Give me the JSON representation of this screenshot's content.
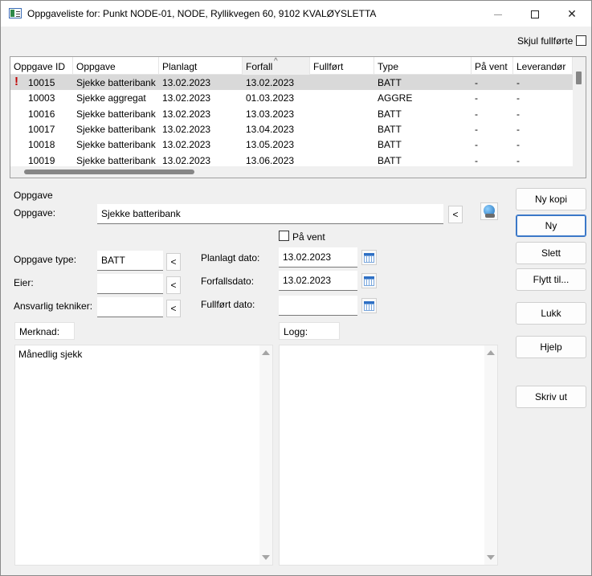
{
  "window": {
    "title": "Oppgaveliste for: Punkt NODE-01, NODE, Ryllikvegen 60, 9102 KVALØYSLETTA"
  },
  "hide_completed_label": "Skjul fullførte",
  "grid": {
    "columns": [
      "Oppgave ID",
      "Oppgave",
      "Planlagt",
      "Forfall",
      "Fullført",
      "Type",
      "På vent",
      "Leverandør"
    ],
    "sort_indicator": "^",
    "rows": [
      {
        "warn": "!",
        "id": "10015",
        "task": "Sjekke batteribank",
        "planned": "13.02.2023",
        "due": "13.02.2023",
        "done": "",
        "type": "BATT",
        "onhold": "-",
        "supplier": "-"
      },
      {
        "warn": "",
        "id": "10003",
        "task": "Sjekke aggregat",
        "planned": "13.02.2023",
        "due": "01.03.2023",
        "done": "",
        "type": "AGGRE",
        "onhold": "-",
        "supplier": "-"
      },
      {
        "warn": "",
        "id": "10016",
        "task": "Sjekke batteribank",
        "planned": "13.02.2023",
        "due": "13.03.2023",
        "done": "",
        "type": "BATT",
        "onhold": "-",
        "supplier": "-"
      },
      {
        "warn": "",
        "id": "10017",
        "task": "Sjekke batteribank",
        "planned": "13.02.2023",
        "due": "13.04.2023",
        "done": "",
        "type": "BATT",
        "onhold": "-",
        "supplier": "-"
      },
      {
        "warn": "",
        "id": "10018",
        "task": "Sjekke batteribank",
        "planned": "13.02.2023",
        "due": "13.05.2023",
        "done": "",
        "type": "BATT",
        "onhold": "-",
        "supplier": "-"
      },
      {
        "warn": "",
        "id": "10019",
        "task": "Sjekke batteribank",
        "planned": "13.02.2023",
        "due": "13.06.2023",
        "done": "",
        "type": "BATT",
        "onhold": "-",
        "supplier": "-"
      }
    ]
  },
  "form": {
    "group_label": "Oppgave",
    "task_label": "Oppgave:",
    "task_value": "Sjekke batteribank",
    "picker_glyph": "<",
    "on_hold_label": "På vent",
    "task_type_label": "Oppgave type:",
    "task_type_value": "BATT",
    "owner_label": "Eier:",
    "owner_value": "",
    "tech_label": "Ansvarlig tekniker:",
    "tech_value": "",
    "planned_date_label": "Planlagt dato:",
    "planned_date_value": "13.02.2023",
    "due_date_label": "Forfallsdato:",
    "due_date_value": "13.02.2023",
    "done_date_label": "Fullført dato:",
    "done_date_value": "",
    "note_label": "Merknad:",
    "note_text": "Månedlig sjekk",
    "log_label": "Logg:",
    "log_text": ""
  },
  "buttons": {
    "new_copy": "Ny kopi",
    "new": "Ny",
    "delete": "Slett",
    "move": "Flytt til...",
    "close": "Lukk",
    "help": "Hjelp",
    "print": "Skriv ut"
  }
}
